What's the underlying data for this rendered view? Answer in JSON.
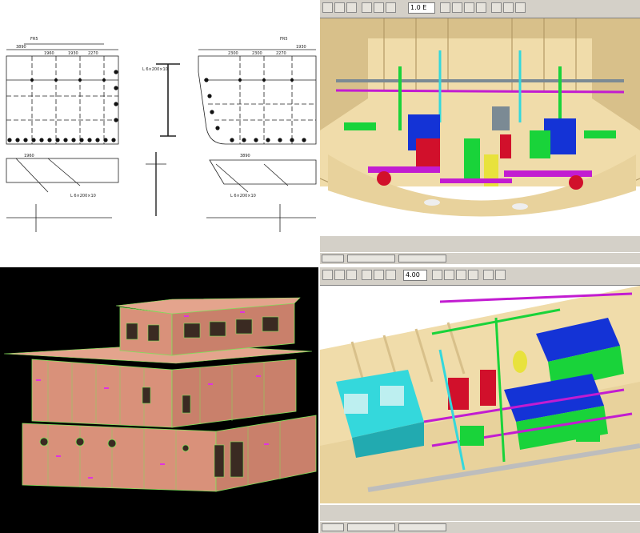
{
  "drawing": {
    "dims": {
      "d1": "3890",
      "d2": "1960",
      "d3": "1930",
      "d4": "2270",
      "d5": "2300",
      "d6": "2300",
      "d7": "2270",
      "d8": "1930",
      "d9": "1960",
      "d10": "3890",
      "fr_left": "FR5",
      "fr_right": "FR5",
      "s1": "L 6×200×10",
      "s2": "L 6×200×10",
      "s3": "L 6×200×10"
    }
  },
  "engine_top": {
    "toolbar_field": "1.0 E"
  },
  "engine_bottom": {
    "toolbar_field": "4.00"
  },
  "colors": {
    "hull": "#f0dcaa",
    "hull_dark": "#d8c08a",
    "blue": "#1433d6",
    "red": "#d1102b",
    "green": "#19d33a",
    "magenta": "#c21cd1",
    "cyan": "#34d8dc",
    "yellow": "#e8e23c",
    "superstructure": "#d9917a",
    "seam": "#7fe05a",
    "mark": "#e033e0"
  }
}
